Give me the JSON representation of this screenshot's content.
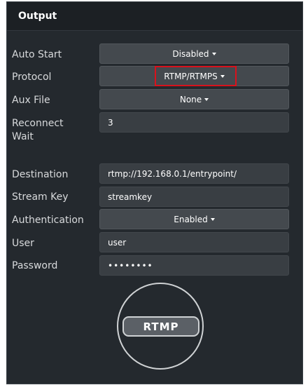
{
  "header": {
    "title": "Output"
  },
  "fields": {
    "auto_start": {
      "label": "Auto Start",
      "value": "Disabled"
    },
    "protocol": {
      "label": "Protocol",
      "value": "RTMP/RTMPS"
    },
    "aux_file": {
      "label": "Aux File",
      "value": "None"
    },
    "reconnect_wait": {
      "label_line1": "Reconnect",
      "label_line2": "Wait",
      "value": "3"
    },
    "destination": {
      "label": "Destination",
      "value": "rtmp://192.168.0.1/entrypoint/"
    },
    "stream_key": {
      "label": "Stream Key",
      "value": "streamkey"
    },
    "authentication": {
      "label": "Authentication",
      "value": "Enabled"
    },
    "user": {
      "label": "User",
      "value": "user"
    },
    "password": {
      "label": "Password",
      "value": "••••••••"
    }
  },
  "start_button": {
    "label": "RTMP"
  },
  "colors": {
    "panel_bg": "#24292e",
    "header_bg": "#1c2024",
    "button_bg": "#44494e",
    "input_bg": "#393e43",
    "highlight": "#d9121c"
  }
}
